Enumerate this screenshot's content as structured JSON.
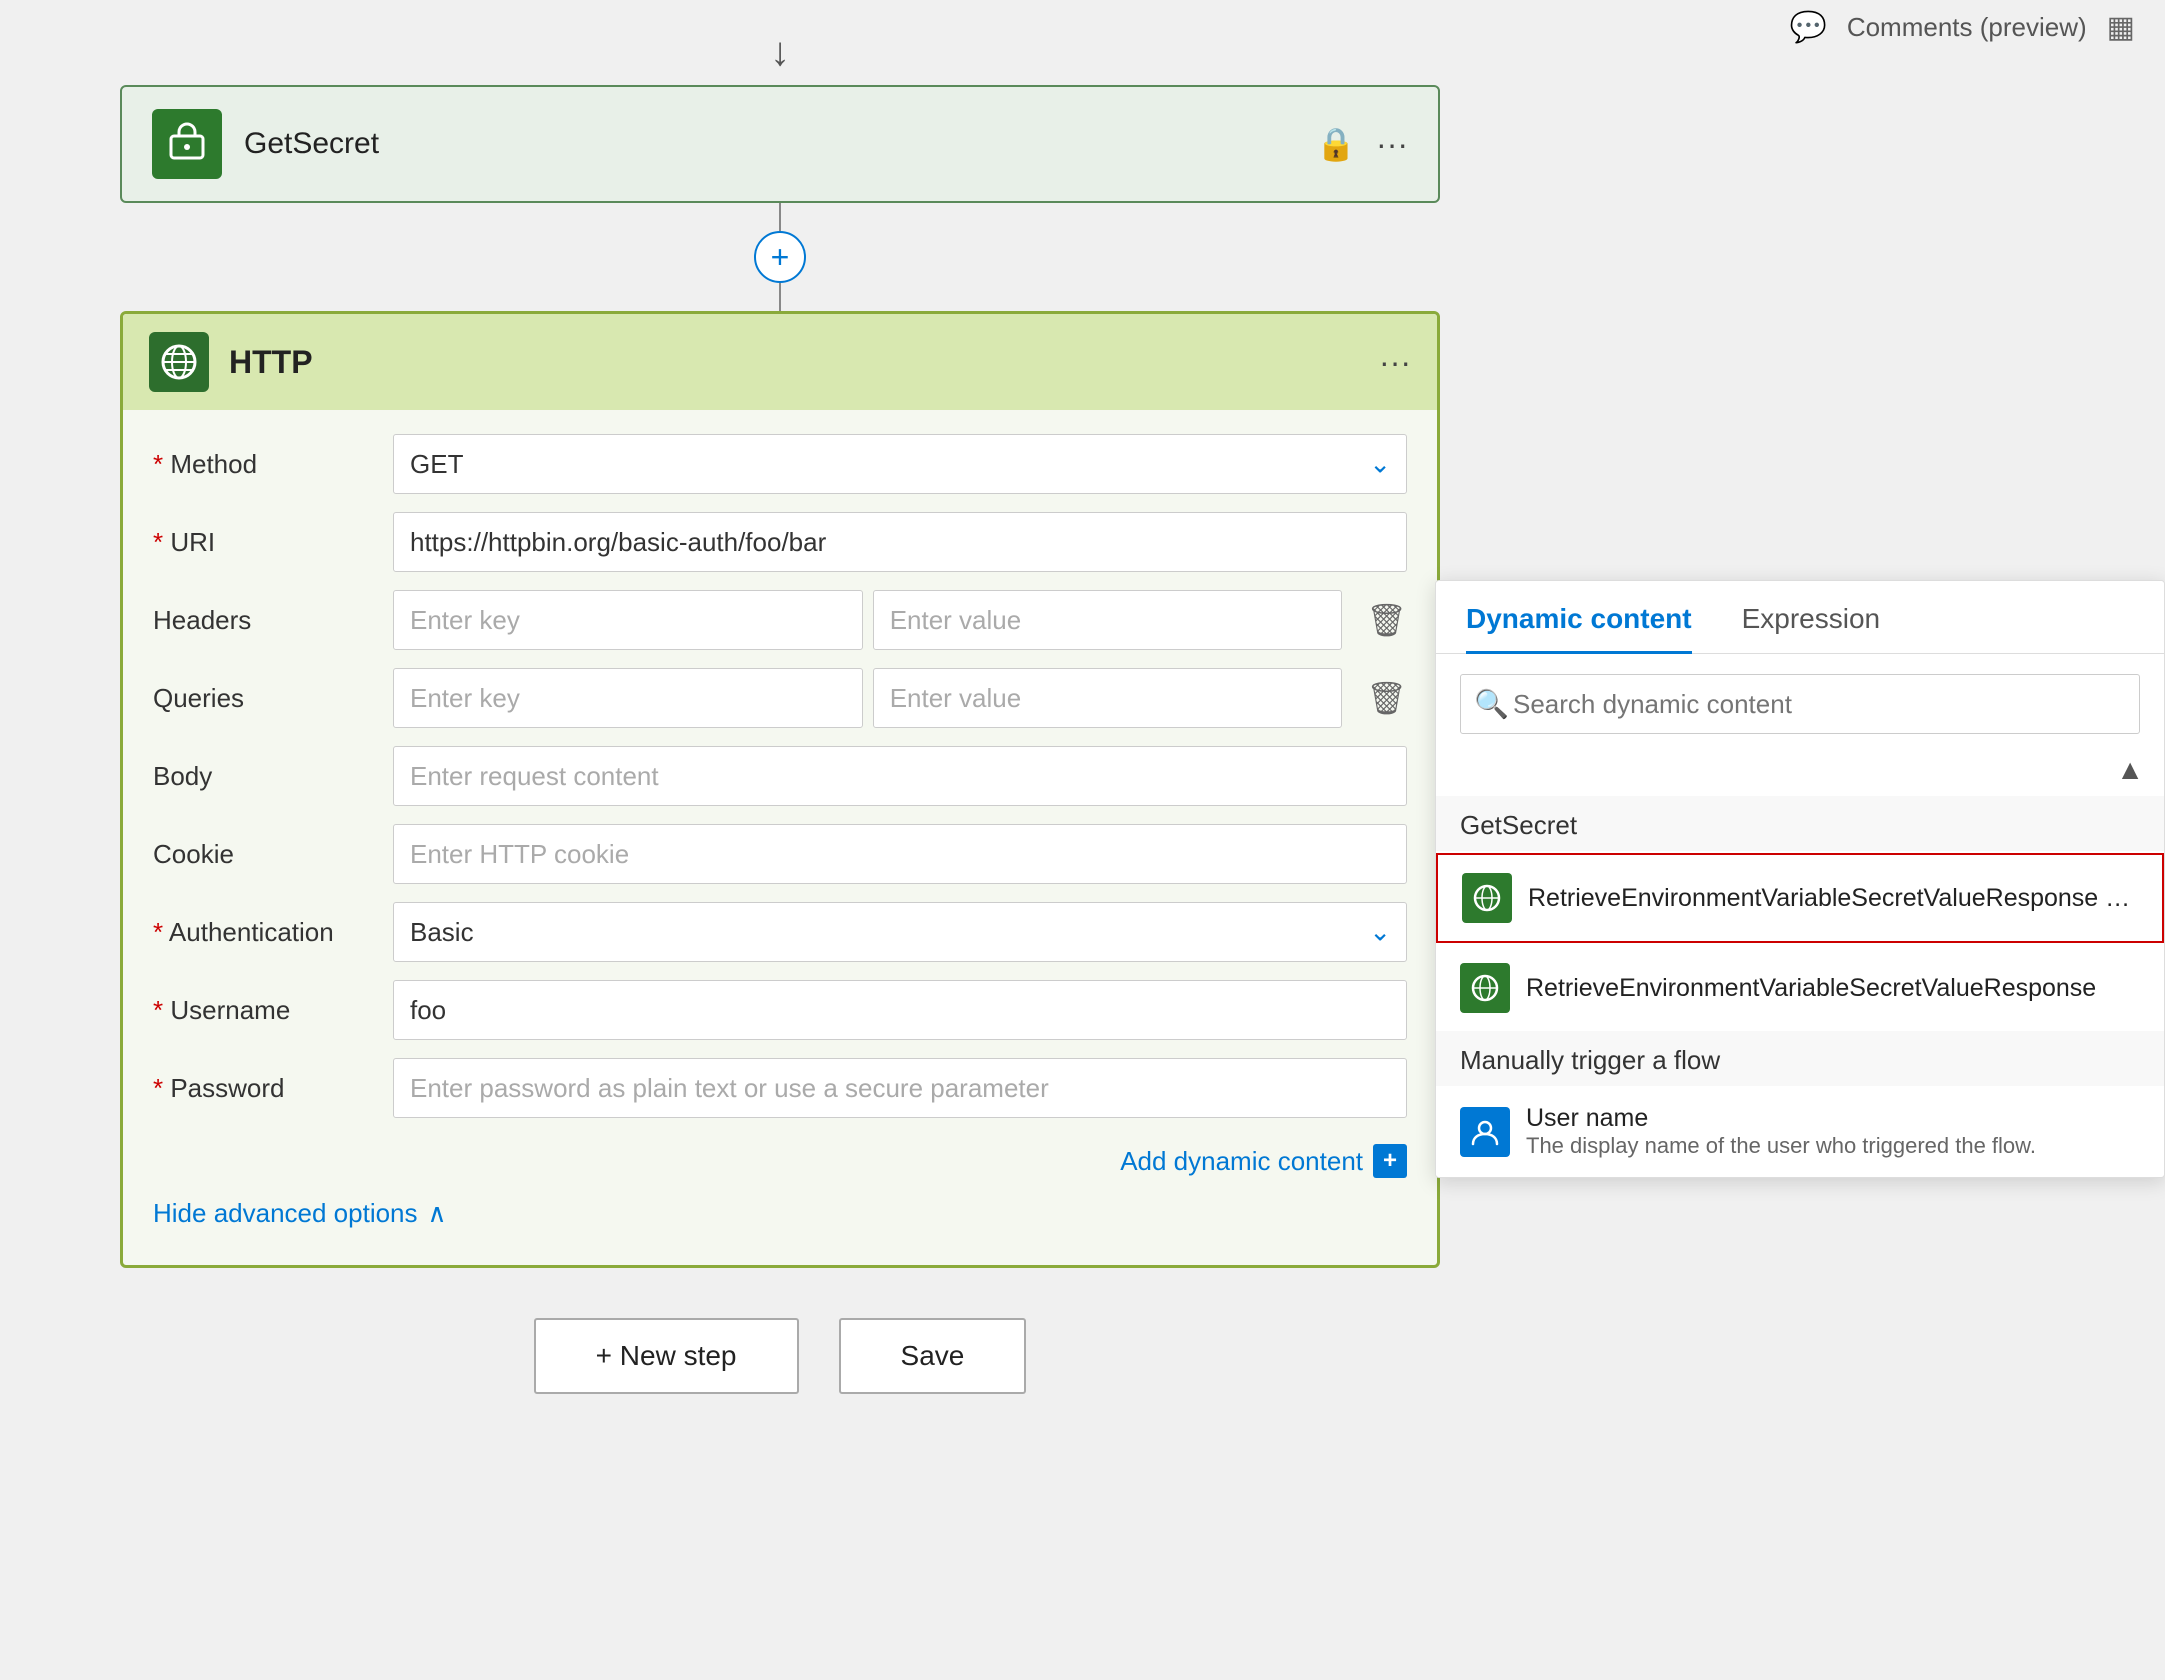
{
  "topbar": {
    "comments_label": "Comments (preview)"
  },
  "get_secret_card": {
    "title": "GetSecret",
    "icon": "🔄"
  },
  "http_card": {
    "title": "HTTP",
    "method_label": "Method",
    "method_value": "GET",
    "uri_label": "URI",
    "uri_value": "https://httpbin.org/basic-auth/foo/bar",
    "headers_label": "Headers",
    "headers_key_placeholder": "Enter key",
    "headers_value_placeholder": "Enter value",
    "queries_label": "Queries",
    "queries_key_placeholder": "Enter key",
    "queries_value_placeholder": "Enter value",
    "body_label": "Body",
    "body_placeholder": "Enter request content",
    "cookie_label": "Cookie",
    "cookie_placeholder": "Enter HTTP cookie",
    "authentication_label": "Authentication",
    "authentication_value": "Basic",
    "username_label": "Username",
    "username_value": "foo",
    "password_label": "Password",
    "password_placeholder": "Enter password as plain text or use a secure parameter",
    "add_dynamic_label": "Add dynamic content",
    "hide_advanced_label": "Hide advanced options"
  },
  "bottom_buttons": {
    "new_step_label": "+ New step",
    "save_label": "Save"
  },
  "dynamic_panel": {
    "tab_dynamic": "Dynamic content",
    "tab_expression": "Expression",
    "search_placeholder": "Search dynamic content",
    "section_getsecret": "GetSecret",
    "item1_label": "RetrieveEnvironmentVariableSecretValueResponse Envi...",
    "item2_label": "RetrieveEnvironmentVariableSecretValueResponse",
    "section_manual": "Manually trigger a flow",
    "item3_label": "User name",
    "item3_sub": "The display name of the user who triggered the flow."
  },
  "icons": {
    "arrow_down": "↓",
    "plus": "+",
    "lock": "🔒",
    "more": "···",
    "chevron_down": "⌄",
    "globe": "🌐",
    "trash": "🗑",
    "search": "🔍",
    "refresh": "↺",
    "chevron_up": "∧",
    "dynamic_plus": "+",
    "person": "👤",
    "scroll_up": "▲"
  }
}
